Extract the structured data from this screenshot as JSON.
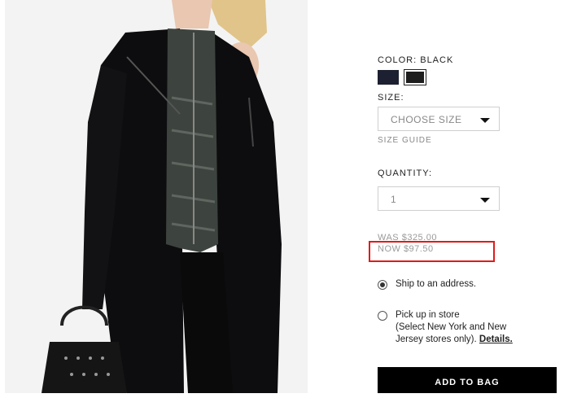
{
  "product": {
    "image_alt": "Woman wearing black wool coat over quilted olive puffer vest, holding studded handbag"
  },
  "color": {
    "label": "COLOR: BLACK",
    "swatches": [
      {
        "name": "navy",
        "hex": "#1c2030",
        "selected": false
      },
      {
        "name": "black",
        "hex": "#1e1e1e",
        "selected": true
      }
    ]
  },
  "size": {
    "label": "SIZE:",
    "selected": "CHOOSE SIZE",
    "guide_link": "SIZE GUIDE"
  },
  "quantity": {
    "label": "QUANTITY:",
    "selected": "1"
  },
  "price": {
    "was": "WAS $325.00",
    "now": "NOW $97.50",
    "highlight_color": "#e01b1b"
  },
  "delivery": {
    "ship": {
      "label": "Ship to an address.",
      "selected": true
    },
    "pickup": {
      "line1": "Pick up in store",
      "line2": "(Select New York and New",
      "line3_prefix": "Jersey stores only).",
      "details_link": "Details.",
      "selected": false
    }
  },
  "add_to_bag": {
    "label": "ADD TO BAG"
  }
}
